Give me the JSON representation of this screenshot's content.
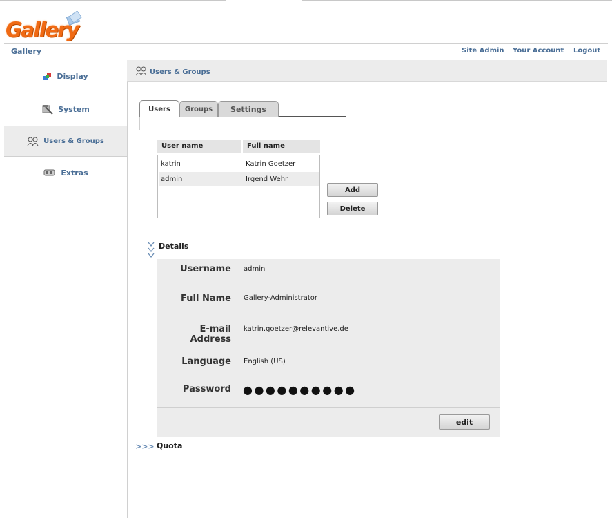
{
  "app": {
    "logo_text": "Gallery",
    "brand_link": "Gallery"
  },
  "nav": {
    "site_admin": "Site Admin",
    "your_account": "Your Account",
    "logout": "Logout"
  },
  "sidebar": {
    "items": [
      {
        "label": "Display",
        "icon": "display-icon"
      },
      {
        "label": "System",
        "icon": "system-tools-icon"
      },
      {
        "label": "Users & Groups",
        "icon": "users-groups-icon",
        "active": true
      },
      {
        "label": "Extras",
        "icon": "extras-icon"
      }
    ]
  },
  "header": {
    "title": "Users & Groups"
  },
  "tabs": [
    {
      "label": "Users",
      "active": true
    },
    {
      "label": "Groups",
      "active": false
    },
    {
      "label": "Settings",
      "active": false
    }
  ],
  "users_table": {
    "columns": [
      "User name",
      "Full name"
    ],
    "rows": [
      {
        "username": "katrin",
        "fullname": "Katrin Goetzer"
      },
      {
        "username": "admin",
        "fullname": "Irgend Wehr",
        "selected": true
      }
    ]
  },
  "buttons": {
    "add": "Add",
    "delete": "Delete",
    "edit": "edit"
  },
  "details": {
    "title": "Details",
    "fields": {
      "username": {
        "label": "Username",
        "value": "admin"
      },
      "fullname": {
        "label": "Full Name",
        "value": "Gallery-Administrator"
      },
      "email": {
        "label": "E-mail Address",
        "value": "katrin.goetzer@relevantive.de"
      },
      "language": {
        "label": "Language",
        "value": "English (US)"
      },
      "password": {
        "label": "Password",
        "value": "●●●●●●●●●●"
      }
    }
  },
  "quota": {
    "title": "Quota",
    "chevron": ">>>"
  },
  "colors": {
    "link": "#4a6e96",
    "logo": "#f06a14",
    "panel": "#ececec"
  }
}
